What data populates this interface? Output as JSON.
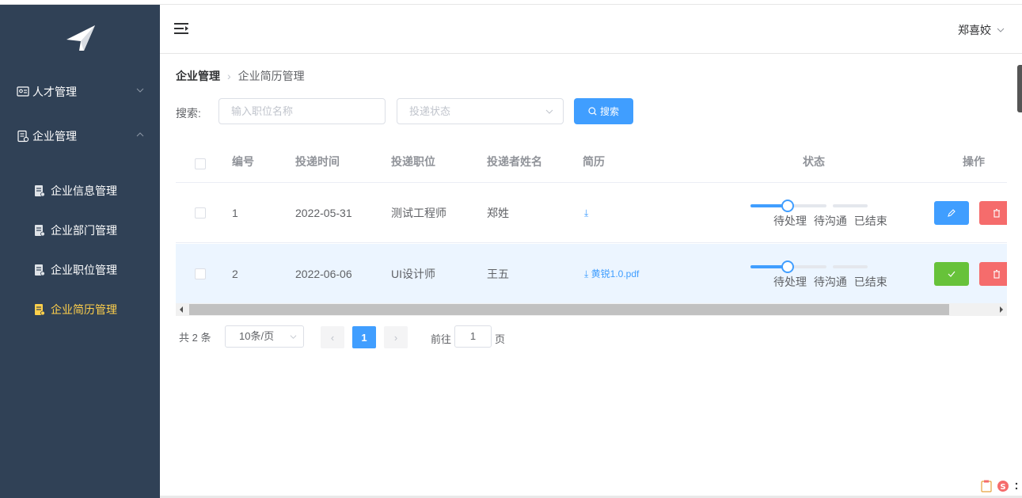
{
  "sidebar": {
    "logo_icon": "paper-plane-icon",
    "menus": [
      {
        "label": "人才管理",
        "icon": "id-card-icon",
        "expanded": false
      },
      {
        "label": "企业管理",
        "icon": "building-doc-icon",
        "expanded": true
      }
    ],
    "sub_items": [
      {
        "label": "企业信息管理",
        "active": false
      },
      {
        "label": "企业部门管理",
        "active": false
      },
      {
        "label": "企业职位管理",
        "active": false
      },
      {
        "label": "企业简历管理",
        "active": true
      }
    ],
    "colors": {
      "bg": "#304156",
      "active": "#ffd04b"
    }
  },
  "header": {
    "user_name": "郑喜姣"
  },
  "breadcrumb": {
    "level1": "企业管理",
    "level2": "企业简历管理"
  },
  "search": {
    "label": "搜索:",
    "position_placeholder": "输入职位名称",
    "status_placeholder": "投递状态",
    "button_label": "搜索"
  },
  "table": {
    "headers": {
      "id": "编号",
      "time": "投递时间",
      "position": "投递职位",
      "name": "投递者姓名",
      "resume": "简历",
      "status": "状态",
      "ops": "操作"
    },
    "status_steps": [
      "待处理",
      "待沟通",
      "已结束"
    ],
    "rows": [
      {
        "id": "1",
        "time": "2022-05-31",
        "position": "测试工程师",
        "name": "郑姓",
        "resume": "",
        "status_step": 0,
        "status_fill": 0.32,
        "highlight": false
      },
      {
        "id": "2",
        "time": "2022-06-06",
        "position": "UI设计师",
        "name": "王五",
        "resume": "黄锐1.0.pdf",
        "status_step": 0,
        "status_fill": 0.32,
        "highlight": true
      }
    ]
  },
  "pagination": {
    "total": "共 2 条",
    "page_size": "10条/页",
    "current_page": "1",
    "goto_label": "前往",
    "goto_value": "1",
    "goto_suffix": "页"
  },
  "colors": {
    "primary": "#409eff",
    "success": "#67c23a",
    "danger": "#f56c6c"
  }
}
